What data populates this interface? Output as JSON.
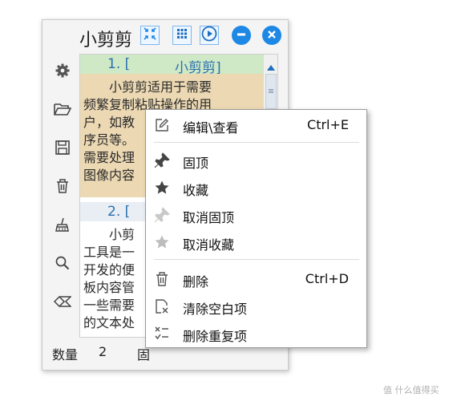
{
  "window": {
    "title": "小剪剪",
    "buttons": [
      {
        "icon": "collapse-arrows-icon",
        "kind": "square"
      },
      {
        "icon": "grid-icon",
        "kind": "square"
      },
      {
        "icon": "play-icon",
        "kind": "square"
      },
      {
        "icon": "minus-icon",
        "kind": "circle"
      },
      {
        "icon": "close-icon",
        "kind": "circle"
      }
    ],
    "accent": "#1e88e5"
  },
  "sidebar": {
    "items": [
      {
        "name": "gear-icon"
      },
      {
        "name": "folder-open-icon"
      },
      {
        "name": "save-icon"
      },
      {
        "name": "trash-icon"
      },
      {
        "name": "broom-icon"
      },
      {
        "name": "search-icon"
      },
      {
        "name": "eraser-icon"
      }
    ]
  },
  "list": {
    "items": [
      {
        "number": "1. [",
        "name": "小剪剪]",
        "lines": [
          "　　小剪剪适用于需要",
          "频繁复制粘贴操作的用",
          "户，如教",
          "序员等。",
          "需要处理",
          "图像内容"
        ],
        "head_color": "#cfe9c6",
        "body_color": "#ecd9b3"
      },
      {
        "number": "2. [",
        "name": "",
        "lines": [
          "　　小剪",
          "工具是一",
          "开发的便",
          "板内容管",
          "一些需要",
          "的文本处"
        ],
        "head_color": "#e9eef5",
        "body_color": "#ffffff"
      }
    ]
  },
  "footer": {
    "count_label": "数量",
    "count_value": "2",
    "extra": "固"
  },
  "context_menu": {
    "groups": [
      [
        {
          "icon": "edit-icon",
          "label": "编辑\\查看",
          "shortcut": "Ctrl+E",
          "disabled": false
        }
      ],
      [
        {
          "icon": "pin-icon",
          "label": "固顶",
          "shortcut": "",
          "disabled": false
        },
        {
          "icon": "star-icon",
          "label": "收藏",
          "shortcut": "",
          "disabled": false
        },
        {
          "icon": "unpin-icon",
          "label": "取消固顶",
          "shortcut": "",
          "disabled": true
        },
        {
          "icon": "unstar-icon",
          "label": "取消收藏",
          "shortcut": "",
          "disabled": true
        }
      ],
      [
        {
          "icon": "trash-icon",
          "label": "删除",
          "shortcut": "Ctrl+D",
          "disabled": false
        },
        {
          "icon": "clear-blank-icon",
          "label": "清除空白项",
          "shortcut": "",
          "disabled": false
        },
        {
          "icon": "remove-duplicate-icon",
          "label": "删除重复项",
          "shortcut": "",
          "disabled": false
        }
      ]
    ]
  },
  "watermark": "值 什么值得买"
}
